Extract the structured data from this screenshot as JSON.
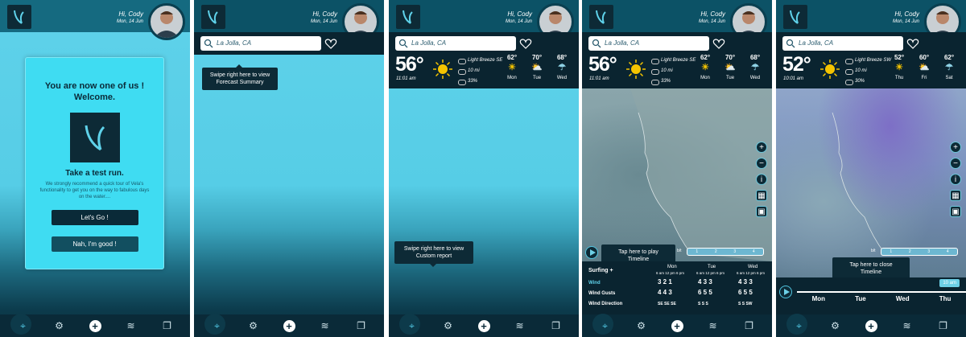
{
  "user": {
    "greeting": "Hi, Cody",
    "date": "Mon, 14 Jun"
  },
  "search": {
    "value": "La Jolla, CA"
  },
  "welcome": {
    "title": "You are now one of us ! Welcome.",
    "subtitle": "Take a test run.",
    "body": "We strongly recommend a quick tour of Vela's functionality to get you on the way to fabulous days on the water....",
    "go": "Let's Go !",
    "no": "Nah, I'm good !"
  },
  "tips": {
    "forecast": "Swipe right here to view Forecast Summary",
    "custom": "Swipe right here to view Custom report",
    "play": "Tap here to play Timeline",
    "close": "Tap here to close Timeline"
  },
  "summary_a": {
    "temp": "56°",
    "time": "11:01 am",
    "wind": "Light Breeze SE",
    "visibility": "10 mi",
    "humidity": "33%",
    "days": [
      {
        "t": "62°",
        "n": "Mon"
      },
      {
        "t": "70°",
        "n": "Tue"
      },
      {
        "t": "68°",
        "n": "Wed"
      }
    ]
  },
  "summary_b": {
    "temp": "52°",
    "time": "10:01 am",
    "wind": "Light Breeze SW",
    "visibility": "10 mi",
    "humidity": "30%",
    "days": [
      {
        "t": "52°",
        "n": "Thu"
      },
      {
        "t": "60°",
        "n": "Fri"
      },
      {
        "t": "62°",
        "n": "Sat"
      }
    ]
  },
  "scale": {
    "unit": "b/t",
    "ticks": [
      "1",
      "2",
      "3",
      "4"
    ]
  },
  "timeline": {
    "activity": "Surfing",
    "days": [
      "Mon",
      "Tue",
      "Wed"
    ],
    "hours": "6 am  12 pm  6 pm",
    "rows": [
      {
        "label": "Wind",
        "unit": "b/t",
        "mon": "3  2  1",
        "tue": "4  3  3",
        "wed": "4  3  3"
      },
      {
        "label": "Wind Gusts",
        "unit": "b/t",
        "mon": "4  4  3",
        "tue": "6  5  5",
        "wed": "6  5  5"
      },
      {
        "label": "Wind Direction",
        "unit": "",
        "mon": "SE SE SE",
        "tue": "S  S  S",
        "wed": "S  S  SW"
      }
    ]
  },
  "timeline_b": {
    "time": "10 am",
    "days": [
      "Mon",
      "Tue",
      "Wed",
      "Thu"
    ]
  },
  "nav": [
    "location-icon",
    "gear-icon",
    "plus-icon",
    "wind-icon",
    "report-icon"
  ]
}
